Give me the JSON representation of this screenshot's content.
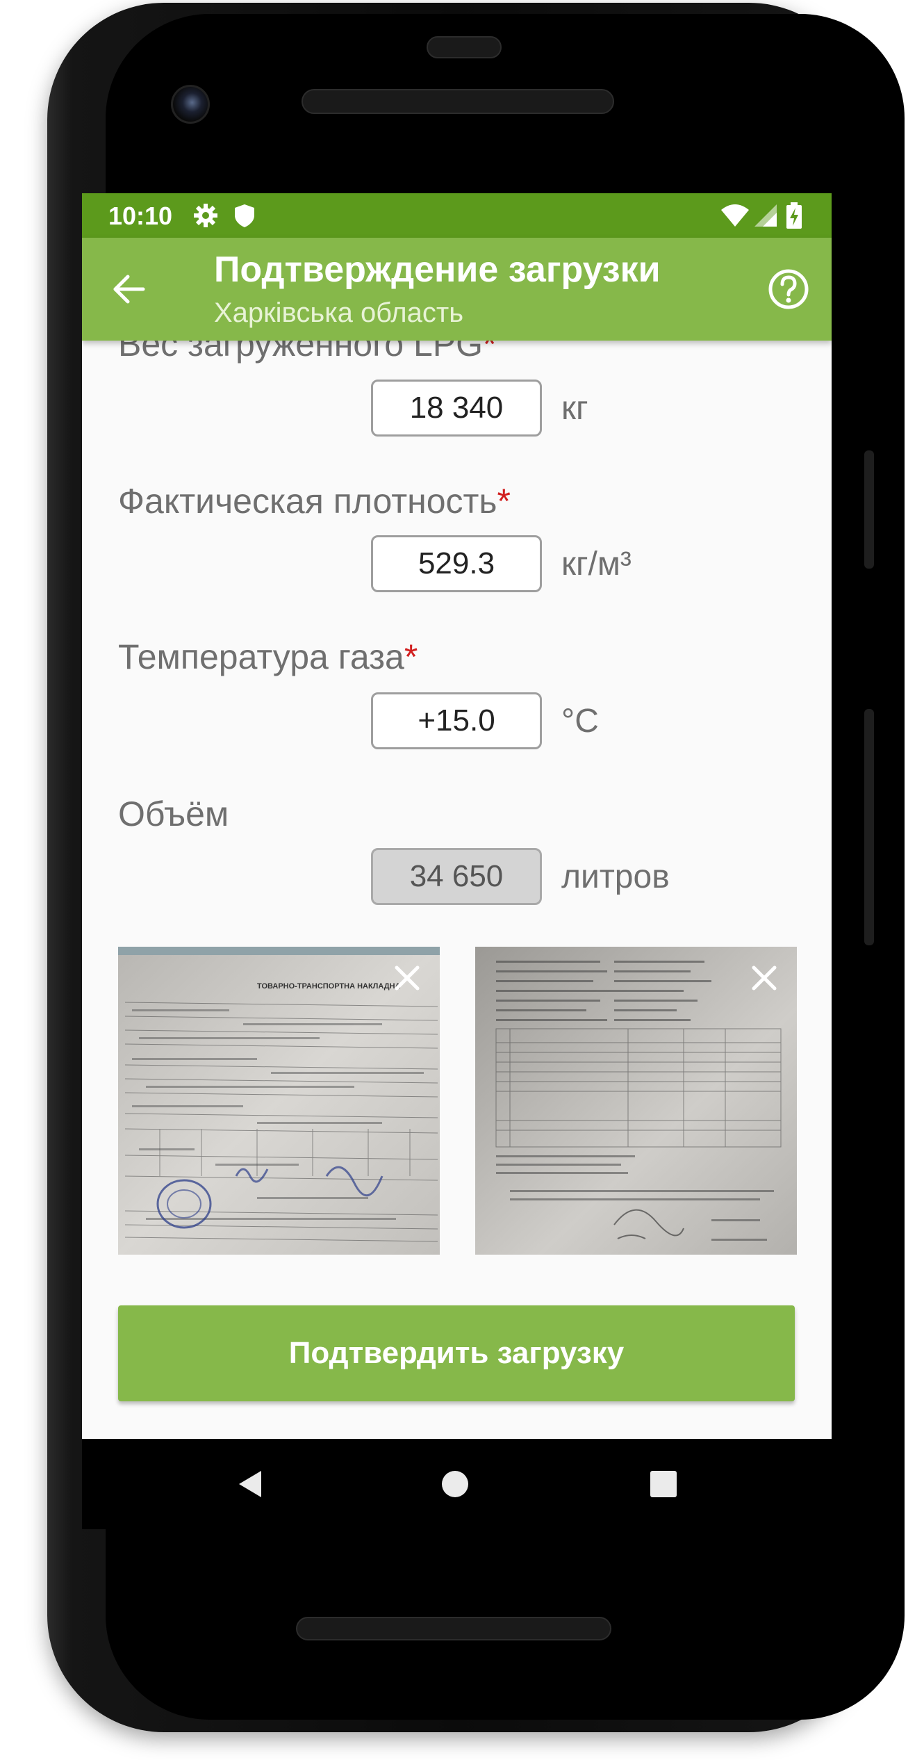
{
  "status_bar": {
    "time": "10:10",
    "icons": [
      "gear-icon",
      "shield-icon",
      "wifi-icon",
      "signal-icon",
      "battery-charging-icon"
    ]
  },
  "app_bar": {
    "title": "Подтверждение загрузки",
    "subtitle": "Харківська область",
    "back_icon": "arrow-back-icon",
    "help_icon": "help-circle-icon"
  },
  "form": {
    "weight": {
      "label": "Вес загруженного LPG",
      "required_mark": "*",
      "value": "18 340",
      "unit": "кг"
    },
    "density": {
      "label": "Фактическая плотность",
      "required_mark": "*",
      "value": "529.3",
      "unit": "кг/м³"
    },
    "temperature": {
      "label": "Температура газа",
      "required_mark": "*",
      "value": "+15.0",
      "unit": "°C"
    },
    "volume": {
      "label": "Объём",
      "value": "34 650",
      "unit": "литров"
    }
  },
  "photos": {
    "items": [
      {
        "name": "waybill-photo",
        "heading": "ТОВАРНО-ТРАНСПОРТНА НАКЛАДНА"
      },
      {
        "name": "quality-certificate-photo"
      }
    ],
    "close_icon": "close-icon"
  },
  "confirm_button": {
    "label": "Подтвердить загрузку"
  },
  "nav_bar": {
    "icons": [
      "back-triangle-icon",
      "home-circle-icon",
      "recents-square-icon"
    ]
  },
  "colors": {
    "status_bar": "#5c9a1c",
    "app_bar": "#86b84a",
    "button": "#86b84a",
    "required": "#d11f1f"
  }
}
